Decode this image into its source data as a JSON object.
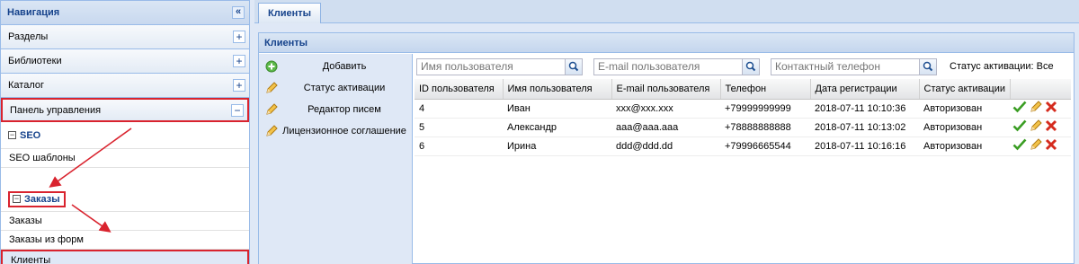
{
  "nav": {
    "title": "Навигация",
    "collapse_glyph": "«",
    "accordion": [
      {
        "label": "Разделы",
        "btn": "+"
      },
      {
        "label": "Библиотеки",
        "btn": "+"
      },
      {
        "label": "Каталог",
        "btn": "+"
      },
      {
        "label": "Панель управления",
        "btn": "−"
      }
    ],
    "seo": {
      "title": "SEO",
      "items": [
        "SEO шаблоны"
      ]
    },
    "orders": {
      "title": "Заказы",
      "items": [
        "Заказы",
        "Заказы из форм",
        "Клиенты"
      ]
    },
    "group_box": "−"
  },
  "tabs": [
    {
      "label": "Клиенты"
    }
  ],
  "panel": {
    "title": "Клиенты",
    "actions": [
      "Добавить",
      "Статус активации",
      "Редактор писем",
      "Лицензионное соглашение"
    ],
    "filters": {
      "username_placeholder": "Имя пользователя",
      "email_placeholder": "E-mail пользователя",
      "phone_placeholder": "Контактный телефон",
      "status_label": "Статус активации: Все"
    },
    "columns": [
      "ID пользователя",
      "Имя пользователя",
      "E-mail пользователя",
      "Телефон",
      "Дата регистрации",
      "Статус активации"
    ],
    "rows": [
      [
        "4",
        "Иван",
        "xxx@xxx.xxx",
        "+79999999999",
        "2018-07-11 10:10:36",
        "Авторизован"
      ],
      [
        "5",
        "Александр",
        "aaa@aaa.aaa",
        "+78888888888",
        "2018-07-11 10:13:02",
        "Авторизован"
      ],
      [
        "6",
        "Ирина",
        "ddd@ddd.dd",
        "+79996665544",
        "2018-07-11 10:16:16",
        "Авторизован"
      ]
    ]
  },
  "icons": {
    "add": "add-icon",
    "edit": "pencil-icon",
    "approve": "checkmark-icon",
    "delete": "delete-icon",
    "search": "search-icon"
  },
  "colors": {
    "header_text": "#15428b",
    "highlight_red": "#d9232e",
    "check_green": "#3a9d23",
    "delete_red": "#d52b1e"
  }
}
